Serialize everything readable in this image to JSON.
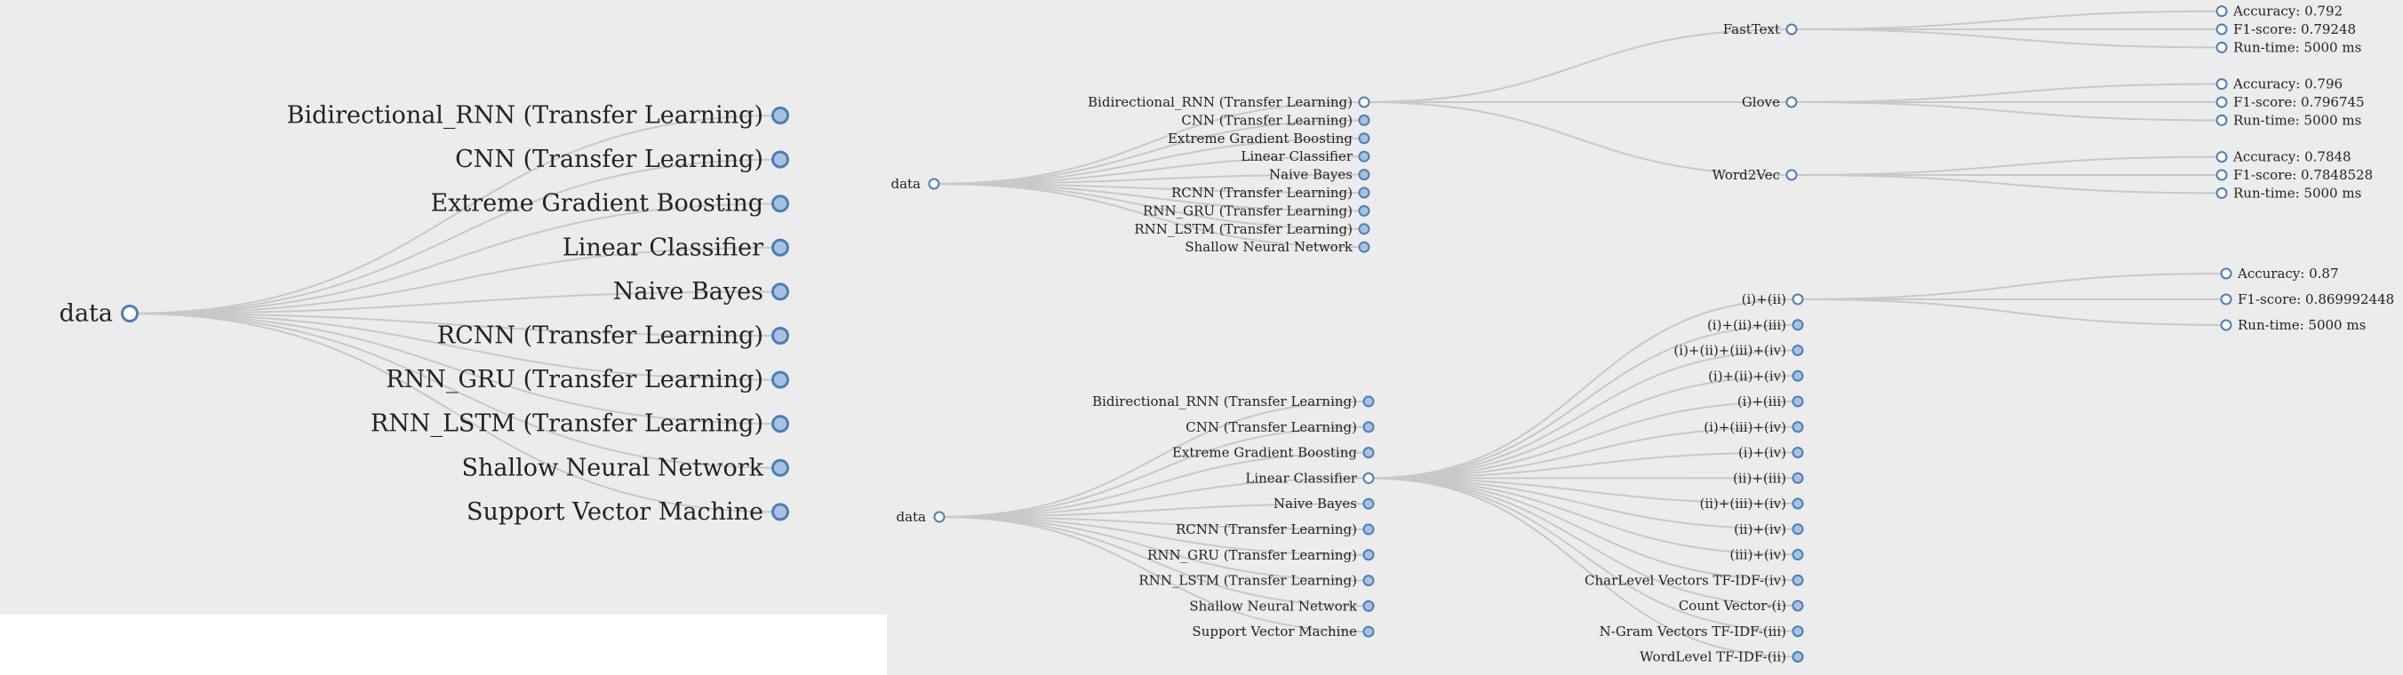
{
  "tree1": {
    "root": "data",
    "children": [
      "Bidirectional_RNN (Transfer Learning)",
      "CNN (Transfer Learning)",
      "Extreme Gradient Boosting",
      "Linear Classifier",
      "Naive Bayes",
      "RCNN (Transfer Learning)",
      "RNN_GRU (Transfer Learning)",
      "RNN_LSTM (Transfer Learning)",
      "Shallow Neural Network",
      "Support Vector Machine"
    ]
  },
  "tree2": {
    "root": "data",
    "children": [
      "Bidirectional_RNN (Transfer Learning)",
      "CNN (Transfer Learning)",
      "Extreme Gradient Boosting",
      "Linear Classifier",
      "Naive Bayes",
      "RCNN (Transfer Learning)",
      "RNN_GRU (Transfer Learning)",
      "RNN_LSTM (Transfer Learning)",
      "Shallow Neural Network"
    ],
    "expanded_child": "Bidirectional_RNN (Transfer Learning)",
    "embeddings": [
      {
        "name": "FastText",
        "metrics": [
          "Accuracy: 0.792",
          "F1-score: 0.79248",
          "Run-time: 5000 ms"
        ]
      },
      {
        "name": "Glove",
        "metrics": [
          "Accuracy: 0.796",
          "F1-score: 0.796745",
          "Run-time: 5000 ms"
        ]
      },
      {
        "name": "Word2Vec",
        "metrics": [
          "Accuracy: 0.7848",
          "F1-score: 0.7848528",
          "Run-time: 5000 ms"
        ]
      }
    ]
  },
  "tree3": {
    "root": "data",
    "children": [
      "Bidirectional_RNN (Transfer Learning)",
      "CNN (Transfer Learning)",
      "Extreme Gradient Boosting",
      "Linear Classifier",
      "Naive Bayes",
      "RCNN (Transfer Learning)",
      "RNN_GRU (Transfer Learning)",
      "RNN_LSTM (Transfer Learning)",
      "Shallow Neural Network",
      "Support Vector Machine"
    ],
    "expanded_child": "Linear Classifier",
    "features": [
      "(i)+(ii)",
      "(i)+(ii)+(iii)",
      "(i)+(ii)+(iii)+(iv)",
      "(i)+(ii)+(iv)",
      "(i)+(iii)",
      "(i)+(iii)+(iv)",
      "(i)+(iv)",
      "(ii)+(iii)",
      "(ii)+(iii)+(iv)",
      "(ii)+(iv)",
      "(iii)+(iv)",
      "CharLevel Vectors TF-IDF-(iv)",
      "Count Vector-(i)",
      "N-Gram Vectors TF-IDF-(iii)",
      "WordLevel TF-IDF-(ii)"
    ],
    "expanded_feature": "(i)+(ii)",
    "metrics": [
      "Accuracy: 0.87",
      "F1-score: 0.869992448",
      "Run-time: 5000 ms"
    ]
  }
}
